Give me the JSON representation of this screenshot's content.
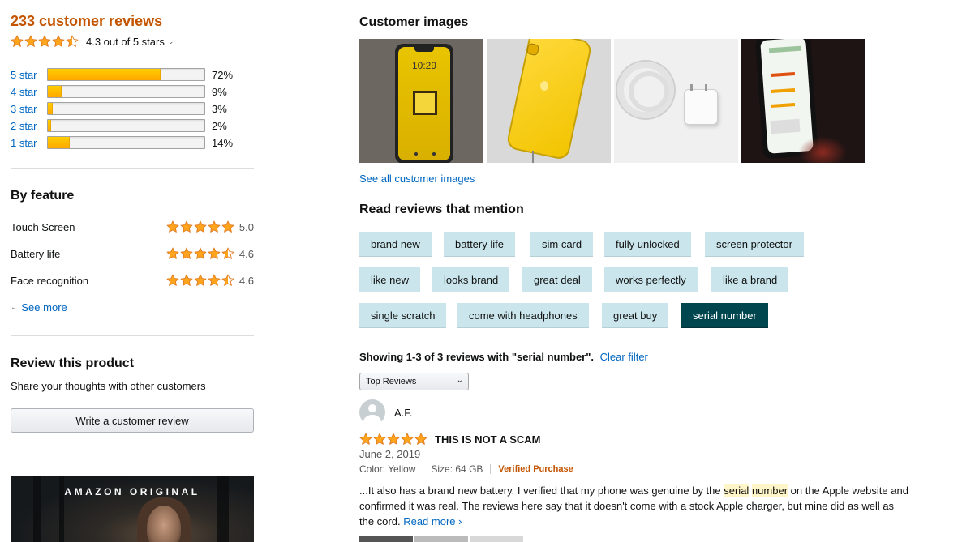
{
  "summary": {
    "review_count": "233 customer reviews",
    "average_text": "4.3 out of 5 stars",
    "average_rating": 4.3
  },
  "histogram": [
    {
      "label": "5 star",
      "percent": 72,
      "percent_text": "72%"
    },
    {
      "label": "4 star",
      "percent": 9,
      "percent_text": "9%"
    },
    {
      "label": "3 star",
      "percent": 3,
      "percent_text": "3%"
    },
    {
      "label": "2 star",
      "percent": 2,
      "percent_text": "2%"
    },
    {
      "label": "1 star",
      "percent": 14,
      "percent_text": "14%"
    }
  ],
  "by_feature": {
    "heading": "By feature",
    "items": [
      {
        "name": "Touch Screen",
        "rating": 5.0,
        "score": "5.0"
      },
      {
        "name": "Battery life",
        "rating": 4.6,
        "score": "4.6"
      },
      {
        "name": "Face recognition",
        "rating": 4.6,
        "score": "4.6"
      }
    ],
    "see_more": "See more"
  },
  "review_product": {
    "heading": "Review this product",
    "subtext": "Share your thoughts with other customers",
    "button": "Write a customer review"
  },
  "promo": {
    "title": "AMAZON ORIGINAL"
  },
  "customer_images": {
    "heading": "Customer images",
    "see_all": "See all customer images",
    "images": [
      {
        "icon": "iphone-yellow-lockscreen-image",
        "time": "10:29"
      },
      {
        "icon": "iphone-yellow-back-image"
      },
      {
        "icon": "charger-cable-image"
      },
      {
        "icon": "phone-screen-review-image"
      }
    ]
  },
  "mentions": {
    "heading": "Read reviews that mention",
    "chips": [
      "brand new",
      "battery life",
      "sim card",
      "fully unlocked",
      "screen protector",
      "like new",
      "looks brand",
      "great deal",
      "works perfectly",
      "like a brand",
      "single scratch",
      "come with headphones",
      "great buy",
      "serial number"
    ],
    "active": "serial number"
  },
  "filter": {
    "showing": "Showing 1-3 of 3 reviews with \"serial number\".",
    "clear": "Clear filter",
    "sort_selected": "Top Reviews"
  },
  "review": {
    "author": "A.F.",
    "rating": 5,
    "title": "THIS IS NOT A SCAM",
    "date": "June 2, 2019",
    "color": "Color: Yellow",
    "size": "Size: 64 GB",
    "verified": "Verified Purchase",
    "body_before": "...It also has a brand new battery. I verified that my phone was genuine by the ",
    "highlight_1": "serial",
    "highlight_2": "number",
    "body_after": " on the Apple website and confirmed it was real. The reviews here say that it doesn't come with a stock Apple charger, but mine did as well as the cord. ",
    "read_more": "Read more ›"
  },
  "colors": {
    "review_count": "#c45500",
    "link": "#0066c0",
    "star": "#ffa41c",
    "chip": "#cae6ec",
    "chip_active": "#00464f"
  }
}
